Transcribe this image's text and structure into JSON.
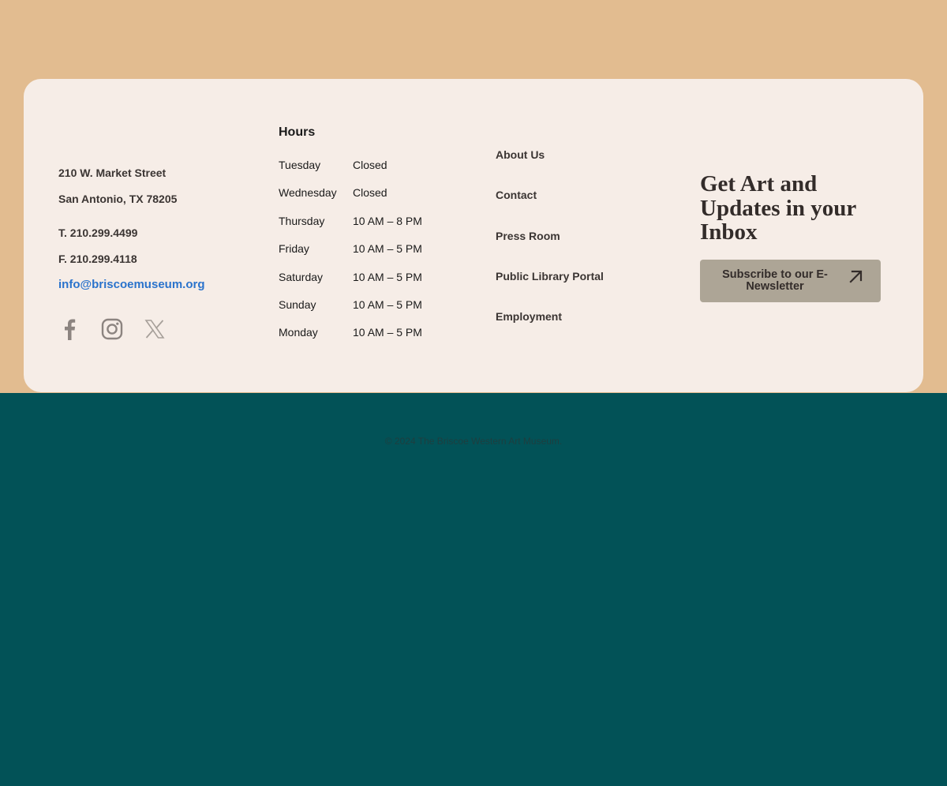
{
  "address": {
    "street": "210 W. Market Street",
    "city": "San Antonio, TX 78205",
    "phone": "T. 210.299.4499",
    "fax": "F. 210.299.4118",
    "email": "info@briscoemuseum.org"
  },
  "social": [
    {
      "name": "facebook-icon"
    },
    {
      "name": "instagram-icon"
    },
    {
      "name": "x-twitter-icon"
    }
  ],
  "hours": {
    "title": "Hours",
    "rows": [
      {
        "day": "Tuesday",
        "time": "Closed"
      },
      {
        "day": "Wednesday",
        "time": "Closed"
      },
      {
        "day": "Thursday",
        "time": "10 AM – 8 PM"
      },
      {
        "day": "Friday",
        "time": "10 AM – 5 PM"
      },
      {
        "day": "Saturday",
        "time": "10 AM – 5 PM"
      },
      {
        "day": "Sunday",
        "time": "10 AM – 5 PM"
      },
      {
        "day": "Monday",
        "time": "10 AM – 5 PM"
      }
    ]
  },
  "links": [
    {
      "label": "About Us"
    },
    {
      "label": "Contact"
    },
    {
      "label": "Press Room"
    },
    {
      "label": "Public Library Portal"
    },
    {
      "label": "Employment"
    }
  ],
  "newsletter": {
    "title": "Get Art and Updates in your Inbox",
    "button_label": "Subscribe to our E-Newsletter"
  },
  "footer": {
    "copyright": "© 2024 The Briscoe Western Art Museum."
  },
  "colors": {
    "top_background": "#e2bc90",
    "bottom_background": "#025257",
    "card_background": "#f6ede7",
    "email_link": "#2a73cc",
    "button_background": "#ada596"
  }
}
